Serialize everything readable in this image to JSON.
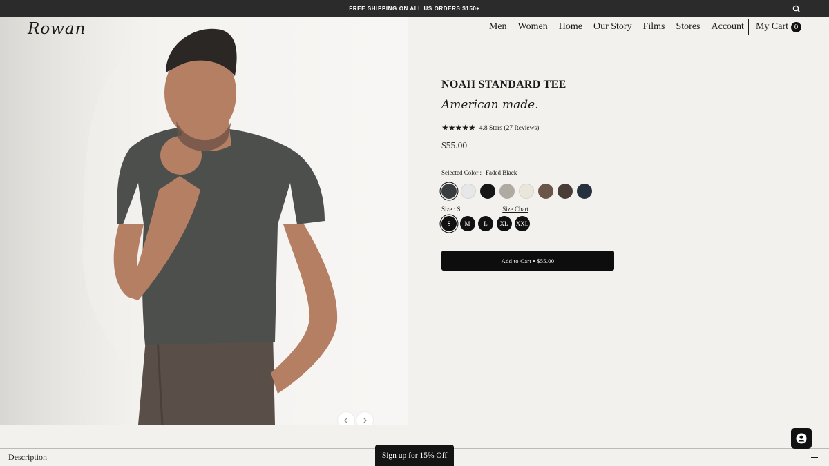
{
  "promo": {
    "text": "FREE SHIPPING ON ALL US ORDERS $150+"
  },
  "header": {
    "logo": "Rowan",
    "nav": [
      "Men",
      "Women",
      "Home",
      "Our Story",
      "Films",
      "Stores",
      "Account"
    ],
    "cart_label": "My Cart",
    "cart_count": "0"
  },
  "product": {
    "title": "NOAH STANDARD TEE",
    "tagline": "American made.",
    "stars": "★★★★★",
    "rating_text": "4.8 Stars (27 Reviews)",
    "price": "$55.00",
    "selected_color_label": "Selected Color :",
    "selected_color": "Faded Black",
    "swatches": [
      "#3a3d40",
      "#e6e7e9",
      "#161616",
      "#b0aba2",
      "#ebe6dc",
      "#6b5448",
      "#4a3d35",
      "#25313d"
    ],
    "size_label": "Size : S",
    "size_chart": "Size Chart",
    "sizes": [
      "S",
      "M",
      "L",
      "XL",
      "XXL"
    ],
    "add_to_cart": "Add to Cart • $55.00"
  },
  "description": {
    "label": "Description"
  },
  "signup": {
    "label": "Sign up for 15% Off"
  },
  "hero_photo": {
    "colors": {
      "shirt": "#4d4f4d",
      "pants": "#5a4f48",
      "skin": "#b47f63"
    }
  }
}
